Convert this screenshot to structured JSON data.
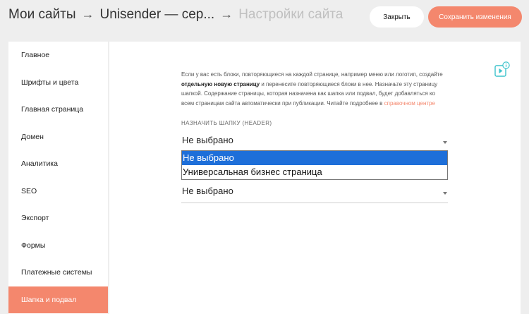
{
  "breadcrumb": {
    "items": [
      "Мои сайты",
      "Unisender — сер...",
      "Настройки сайта"
    ],
    "separator": "→"
  },
  "header": {
    "close_label": "Закрыть",
    "save_label": "Сохранить изменения"
  },
  "sidebar": {
    "items": [
      {
        "label": "Главное"
      },
      {
        "label": "Шрифты и цвета"
      },
      {
        "label": "Главная страница"
      },
      {
        "label": "Домен"
      },
      {
        "label": "Аналитика"
      },
      {
        "label": "SEO"
      },
      {
        "label": "Экспорт"
      },
      {
        "label": "Формы"
      },
      {
        "label": "Платежные системы"
      },
      {
        "label": "Шапка и подвал"
      }
    ],
    "active_index": 9
  },
  "main": {
    "description": {
      "part1": "Если у вас есть блоки, повторяющиеся на каждой странице, например меню или логотип, создайте ",
      "bold": "отдельную новую страницу",
      "part2": " и перенесите повторяющиеся блоки в нее. Назначьте эту страницу шапкой. Содержание страницы, которая назначена как шапка или подвал, будет добавляться ко всем страницам сайта автоматически при публикации. Читайте подробнее в ",
      "link": "справочном центре"
    },
    "header_field": {
      "label": "НАЗНАЧИТЬ ШАПКУ (HEADER)",
      "value": "Не выбрано"
    },
    "footer_field": {
      "value": "Не выбрано"
    },
    "dropdown": {
      "options": [
        "Не выбрано",
        "Универсальная бизнес страница"
      ],
      "selected_index": 0
    },
    "video_help_icon": "video-play-info-icon"
  },
  "colors": {
    "accent": "#f4876d",
    "selection": "#1e6fd9",
    "background": "#eeeeee"
  }
}
